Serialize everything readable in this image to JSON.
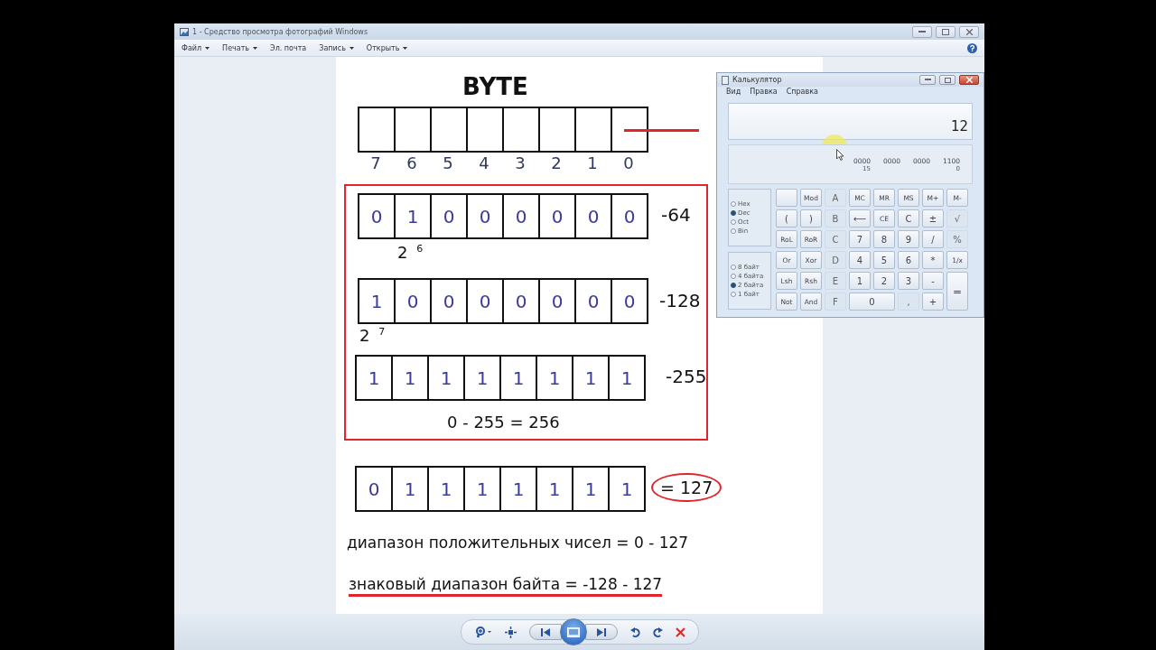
{
  "window": {
    "title": "1 - Средство просмотра фотографий Windows"
  },
  "menu": [
    {
      "label": "Файл",
      "dropdown": true
    },
    {
      "label": "Печать",
      "dropdown": true
    },
    {
      "label": "Эл. почта",
      "dropdown": false
    },
    {
      "label": "Запись",
      "dropdown": true
    },
    {
      "label": "Открыть",
      "dropdown": true
    }
  ],
  "slide": {
    "title": "BYTE",
    "header_indices": [
      "7",
      "6",
      "5",
      "4",
      "3",
      "2",
      "1",
      "0"
    ],
    "rows": [
      {
        "bits": [
          "0",
          "1",
          "0",
          "0",
          "0",
          "0",
          "0",
          "0"
        ],
        "value": "-64",
        "power": "2 $^{6}$"
      },
      {
        "bits": [
          "1",
          "0",
          "0",
          "0",
          "0",
          "0",
          "0",
          "0"
        ],
        "value": "-128",
        "power": "2 $^{7}$"
      },
      {
        "bits": [
          "1",
          "1",
          "1",
          "1",
          "1",
          "1",
          "1",
          "1"
        ],
        "value": "-255"
      }
    ],
    "sum": "0 - 255 = 256",
    "result": {
      "bits": [
        "0",
        "1",
        "1",
        "1",
        "1",
        "1",
        "1",
        "1"
      ],
      "value": "= 127"
    },
    "notes": [
      {
        "text": "диапазон положительных чисел = 0 - 127",
        "underlined": false
      },
      {
        "text": "знаковый диапазон байта = -128 - 127",
        "underlined": true
      }
    ]
  },
  "calculator": {
    "title": "Калькулятор",
    "menu": [
      "Вид",
      "Правка",
      "Справка"
    ],
    "display": "12",
    "binary": [
      "0000",
      "0000",
      "0000",
      "1100"
    ],
    "bit_positions": [
      "15",
      "0"
    ],
    "bases": [
      {
        "label": "Hex",
        "selected": false
      },
      {
        "label": "Dec",
        "selected": true
      },
      {
        "label": "Oct",
        "selected": false
      },
      {
        "label": "Bin",
        "selected": false
      }
    ],
    "word_sizes": [
      {
        "label": "8 байт",
        "selected": false
      },
      {
        "label": "4 байта",
        "selected": false
      },
      {
        "label": "2 байта",
        "selected": true
      },
      {
        "label": "1 байт",
        "selected": false
      }
    ],
    "keys": [
      {
        "kind": "blank",
        "disabled": false
      },
      {
        "kind": "key",
        "label": "Mod",
        "disabled": false
      },
      {
        "kind": "key",
        "label": "A",
        "disabled": true
      },
      {
        "kind": "key",
        "label": "MC",
        "disabled": false
      },
      {
        "kind": "key",
        "label": "MR",
        "disabled": false
      },
      {
        "kind": "key",
        "label": "MS",
        "disabled": false
      },
      {
        "kind": "key",
        "label": "M+",
        "disabled": false
      },
      {
        "kind": "key",
        "label": "M-",
        "disabled": false
      },
      {
        "kind": "key",
        "label": "(",
        "disabled": false
      },
      {
        "kind": "key",
        "label": ")",
        "disabled": false
      },
      {
        "kind": "key",
        "label": "B",
        "disabled": true
      },
      {
        "kind": "key",
        "label": "⟵",
        "disabled": false
      },
      {
        "kind": "key",
        "label": "CE",
        "disabled": false
      },
      {
        "kind": "key",
        "label": "C",
        "disabled": false
      },
      {
        "kind": "key",
        "label": "±",
        "disabled": false
      },
      {
        "kind": "key",
        "label": "√",
        "disabled": true
      },
      {
        "kind": "key",
        "label": "RoL",
        "disabled": false
      },
      {
        "kind": "key",
        "label": "RoR",
        "disabled": false
      },
      {
        "kind": "key",
        "label": "C",
        "disabled": true
      },
      {
        "kind": "key",
        "label": "7",
        "disabled": false
      },
      {
        "kind": "key",
        "label": "8",
        "disabled": false
      },
      {
        "kind": "key",
        "label": "9",
        "disabled": false
      },
      {
        "kind": "key",
        "label": "/",
        "disabled": false
      },
      {
        "kind": "key",
        "label": "%",
        "disabled": true
      },
      {
        "kind": "key",
        "label": "Or",
        "disabled": false
      },
      {
        "kind": "key",
        "label": "Xor",
        "disabled": false
      },
      {
        "kind": "key",
        "label": "D",
        "disabled": true
      },
      {
        "kind": "key",
        "label": "4",
        "disabled": false
      },
      {
        "kind": "key",
        "label": "5",
        "disabled": false
      },
      {
        "kind": "key",
        "label": "6",
        "disabled": false
      },
      {
        "kind": "key",
        "label": "*",
        "disabled": false
      },
      {
        "kind": "key",
        "label": "1/x",
        "disabled": false
      },
      {
        "kind": "key",
        "label": "Lsh",
        "disabled": false
      },
      {
        "kind": "key",
        "label": "Rsh",
        "disabled": false
      },
      {
        "kind": "key",
        "label": "E",
        "disabled": true
      },
      {
        "kind": "key",
        "label": "1",
        "disabled": false
      },
      {
        "kind": "key",
        "label": "2",
        "disabled": false
      },
      {
        "kind": "key",
        "label": "3",
        "disabled": false
      },
      {
        "kind": "key",
        "label": "-",
        "disabled": false
      },
      {
        "kind": "tall",
        "label": "=",
        "disabled": false
      },
      {
        "kind": "key",
        "label": "Not",
        "disabled": false
      },
      {
        "kind": "key",
        "label": "And",
        "disabled": false
      },
      {
        "kind": "key",
        "label": "F",
        "disabled": true
      },
      {
        "kind": "wide",
        "label": "0",
        "disabled": false
      },
      {
        "kind": "key",
        "label": ",",
        "disabled": true
      },
      {
        "kind": "key",
        "label": "+",
        "disabled": false
      }
    ]
  }
}
